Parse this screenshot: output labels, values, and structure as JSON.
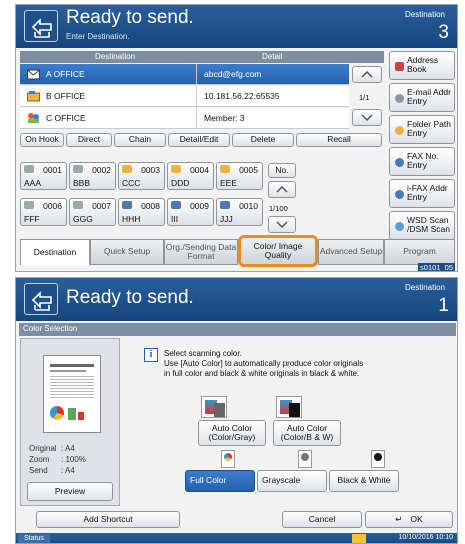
{
  "top": {
    "title": "Ready to send.",
    "subtitle": "Enter Destination.",
    "dest_label": "Destination",
    "dest_count": "3",
    "columns": {
      "destination": "Destination",
      "detail": "Detail"
    },
    "rows": [
      {
        "name": "A OFFICE",
        "detail": "abcd@efg.com",
        "icon": "email-icon"
      },
      {
        "name": "B OFFICE",
        "detail": "10.181.56.22:65535",
        "icon": "folder-icon"
      },
      {
        "name": "C OFFICE",
        "detail": "Member:  3",
        "icon": "group-icon"
      }
    ],
    "page_indicator": "1/1",
    "actions": [
      "On Hook",
      "Direct",
      "Chain",
      "Detail/Edit",
      "Delete",
      "Recall"
    ],
    "onetouch": [
      {
        "num": "0001",
        "name": "AAA",
        "icon": "email-icon"
      },
      {
        "num": "0002",
        "name": "BBB",
        "icon": "email-icon"
      },
      {
        "num": "0003",
        "name": "CCC",
        "icon": "folder-icon"
      },
      {
        "num": "0004",
        "name": "DDD",
        "icon": "folder-icon"
      },
      {
        "num": "0005",
        "name": "EEE",
        "icon": "folder-icon"
      },
      {
        "num": "0006",
        "name": "FFF",
        "icon": "email-icon"
      },
      {
        "num": "0007",
        "name": "GGG",
        "icon": "email-icon"
      },
      {
        "num": "0008",
        "name": "HHH",
        "icon": "fax-icon"
      },
      {
        "num": "0009",
        "name": "III",
        "icon": "fax-icon"
      },
      {
        "num": "0010",
        "name": "JJJ",
        "icon": "fax-icon"
      }
    ],
    "no_label": "No.",
    "key_page": "1/100",
    "side": [
      "Address Book",
      "E-mail Addr Entry",
      "Folder Path Entry",
      "FAX No. Entry",
      "i-FAX Addr Entry",
      "WSD Scan /DSM Scan"
    ],
    "tabs": [
      "Destination",
      "Quick Setup",
      "Org./Sending Data Format",
      "Color/ Image Quality",
      "Advanced Setup",
      "Program"
    ],
    "screen_id": "s0101_05"
  },
  "bottom": {
    "title": "Ready to send.",
    "dest_label": "Destination",
    "dest_count": "1",
    "panel_title": "Color Selection",
    "info_lines": [
      "Select scanning color.",
      "Use [Auto Color] to automatically produce color originals",
      "in full color and black & white originals in black & white."
    ],
    "preview_info": [
      {
        "label": "Original",
        "value": ": A4"
      },
      {
        "label": "Zoom",
        "value": ": 100%"
      },
      {
        "label": "Send",
        "value": ": A4"
      }
    ],
    "preview_label": "Preview",
    "options_row1": [
      "Auto Color (Color/Gray)",
      "Auto Color (Color/B & W)"
    ],
    "options_row2": [
      "Full Color",
      "Grayscale",
      "Black & White"
    ],
    "add_shortcut": "Add Shortcut",
    "cancel": "Cancel",
    "ok": "OK",
    "status": "Status",
    "datetime": "10/10/2016  10:10"
  },
  "colors": {
    "header": "#1f4f8a",
    "selected": "#2d6dbf",
    "highlight": "#f08a1c"
  }
}
